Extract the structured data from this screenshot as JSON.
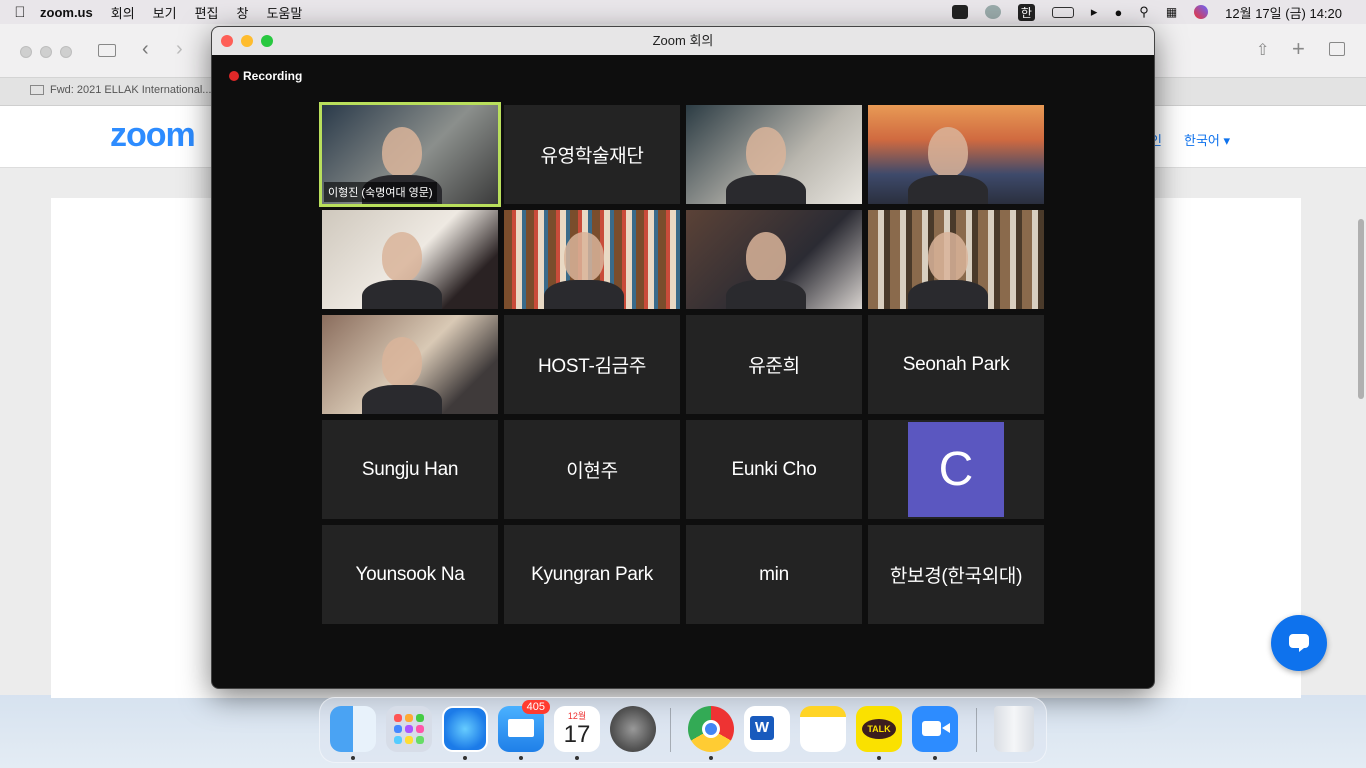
{
  "menubar": {
    "app": "zoom.us",
    "items": [
      "회의",
      "보기",
      "편집",
      "창",
      "도움말"
    ],
    "ime": "한",
    "clock": "12월 17일 (금)  14:20"
  },
  "browser": {
    "tab_title": "Fwd: 2021 ELLAK International...",
    "page_logo": "zoom",
    "lang": "한국어",
    "join_link": "인"
  },
  "zoom": {
    "window_title": "Zoom 회의",
    "recording": "Recording",
    "active_caption": "이형진 (숙명여대 영문)",
    "tiles": [
      {
        "name": "",
        "video": true
      },
      {
        "name": "유영학술재단",
        "video": false
      },
      {
        "name": "",
        "video": true
      },
      {
        "name": "",
        "video": true
      },
      {
        "name": "",
        "video": true
      },
      {
        "name": "",
        "video": true
      },
      {
        "name": "",
        "video": true
      },
      {
        "name": "",
        "video": true
      },
      {
        "name": "",
        "video": true
      },
      {
        "name": "HOST-김금주",
        "video": false
      },
      {
        "name": "유준희",
        "video": false
      },
      {
        "name": "Seonah Park",
        "video": false
      },
      {
        "name": "Sungju Han",
        "video": false
      },
      {
        "name": "이현주",
        "video": false
      },
      {
        "name": "Eunki Cho",
        "video": false
      },
      {
        "name": "C",
        "video": false,
        "avatar": true
      },
      {
        "name": "Younsook Na",
        "video": false
      },
      {
        "name": "Kyungran Park",
        "video": false
      },
      {
        "name": "min",
        "video": false
      },
      {
        "name": "한보경(한국외대)",
        "video": false
      }
    ]
  },
  "dock": {
    "mail_badge": "405",
    "calendar_month": "12월",
    "calendar_day": "17",
    "talk_label": "TALK",
    "icons": [
      "finder-icon",
      "launchpad-icon",
      "safari-icon",
      "mail-icon",
      "calendar-icon",
      "system-preferences-icon",
      "chrome-icon",
      "word-icon",
      "notes-icon",
      "kakaotalk-icon",
      "zoom-icon",
      "trash-icon"
    ]
  }
}
